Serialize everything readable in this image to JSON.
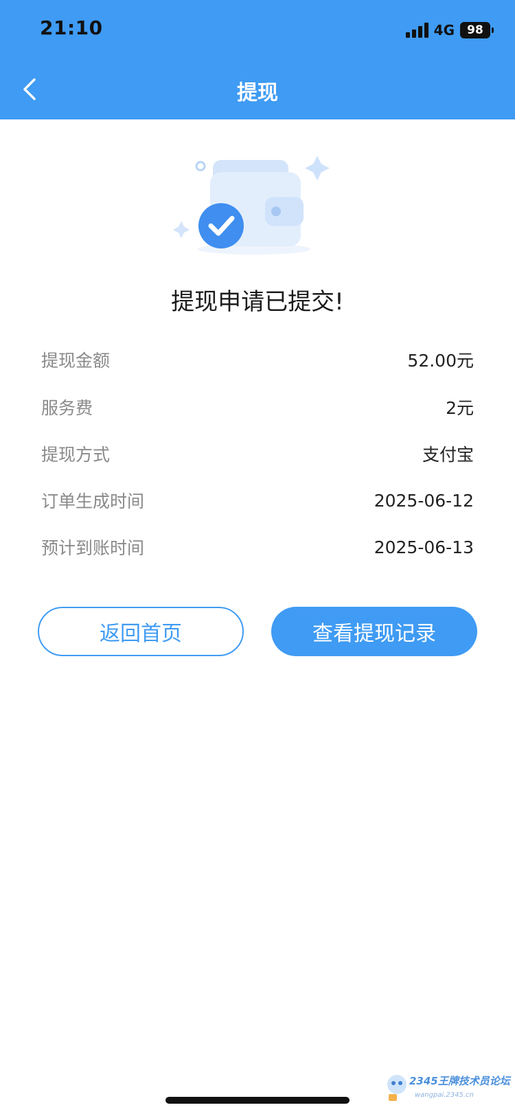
{
  "status_bar": {
    "time": "21:10",
    "network": "4G",
    "battery": "98"
  },
  "nav": {
    "title": "提现",
    "back_icon": "chevron-left-icon"
  },
  "result": {
    "illustration_icon": "wallet-check-icon",
    "headline": "提现申请已提交!"
  },
  "details": [
    {
      "label": "提现金额",
      "value": "52.00元"
    },
    {
      "label": "服务费",
      "value": "2元"
    },
    {
      "label": "提现方式",
      "value": "支付宝"
    },
    {
      "label": "订单生成时间",
      "value": "2025-06-12"
    },
    {
      "label": "预计到账时间",
      "value": "2025-06-13"
    }
  ],
  "buttons": {
    "home": "返回首页",
    "records": "查看提现记录"
  },
  "watermark": {
    "text": "2345王牌技术员论坛",
    "sub": "wangpai.2345.cn"
  },
  "colors": {
    "primary": "#3f9bf3",
    "label": "#8a8a8a"
  }
}
